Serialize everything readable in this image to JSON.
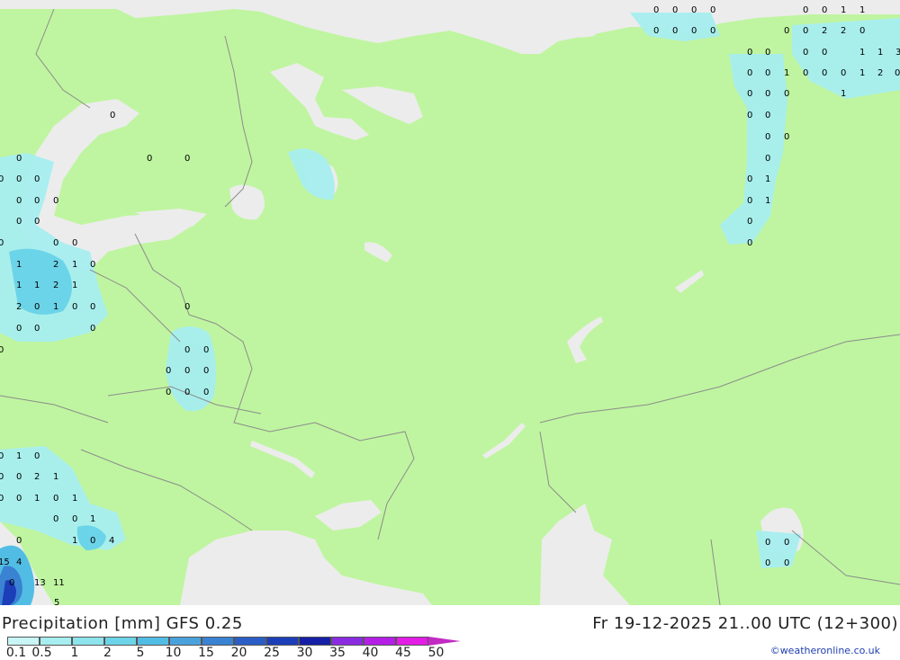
{
  "title": "Precipitation [mm] GFS 0.25",
  "valid_time": "Fr 19-12-2025 21..00 UTC (12+300)",
  "copyright": "©weatheronline.co.uk",
  "colors": {
    "land": "#bff5a0",
    "sea": "#ececec",
    "border": "#8c8c8c"
  },
  "legend": {
    "labels": [
      "0.1",
      "0.5",
      "1",
      "2",
      "5",
      "10",
      "15",
      "20",
      "25",
      "30",
      "35",
      "40",
      "45",
      "50"
    ],
    "colors": [
      "#c8f5f5",
      "#a6eef0",
      "#8ee4ec",
      "#6cd4e8",
      "#52bde4",
      "#4aa2dc",
      "#3a82d2",
      "#2a5ec6",
      "#1c3eb8",
      "#1520a6",
      "#8a2be2",
      "#b41ee6",
      "#e31ce6",
      "#c22ac4"
    ]
  },
  "precip_values": [
    {
      "group": "arctic-e",
      "items": [
        "0",
        "0",
        "0",
        "0",
        "0",
        "0",
        "1",
        "1",
        "0",
        "0",
        "0",
        "0",
        "0",
        "0",
        "2",
        "2",
        "0",
        "0",
        "0",
        "0",
        "0",
        "1",
        "1",
        "3",
        "0",
        "0",
        "1",
        "0",
        "0",
        "0",
        "1",
        "2",
        "0",
        "0",
        "0",
        "0",
        "1",
        "0",
        "0",
        "0",
        "0",
        "0",
        "0",
        "1",
        "0",
        "1",
        "0",
        "0"
      ]
    },
    {
      "group": "scandinavia",
      "items": [
        "0",
        "0",
        "0",
        "0",
        "0",
        "0",
        "0",
        "0",
        "0",
        "0",
        "0",
        "0",
        "0",
        "0",
        "0"
      ]
    },
    {
      "group": "baltic",
      "items": [
        "1",
        "2",
        "1",
        "0",
        "1",
        "1",
        "2",
        "1",
        "2",
        "0",
        "1",
        "0",
        "0",
        "0",
        "0",
        "0",
        "0"
      ]
    },
    {
      "group": "belarus",
      "items": [
        "0",
        "0",
        "0",
        "0",
        "0",
        "0",
        "0",
        "0",
        "0"
      ]
    },
    {
      "group": "balkans",
      "items": [
        "0",
        "1",
        "0",
        "0",
        "0",
        "2",
        "1",
        "0",
        "0",
        "1",
        "0",
        "1",
        "0",
        "0",
        "1",
        "0",
        "1",
        "0",
        "4",
        "15",
        "4",
        "0",
        "13",
        "11",
        "5"
      ]
    },
    {
      "group": "kazakh",
      "items": [
        "0",
        "0",
        "0",
        "0"
      ]
    }
  ]
}
